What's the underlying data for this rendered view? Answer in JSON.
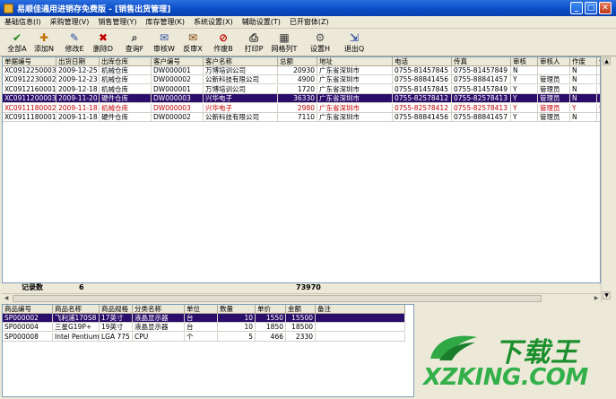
{
  "window": {
    "title": "易顺佳通用进销存免费版 - [销售出货管理]"
  },
  "menu": [
    "基础信息(I)",
    "采购管理(V)",
    "销售管理(Y)",
    "库存管理(K)",
    "系统设置(X)",
    "辅助设置(T)",
    "已开窗体(Z)"
  ],
  "toolbar": [
    {
      "label": "全部A",
      "icon": "check-icon",
      "glyph": "✔",
      "color": "#1f8a1f"
    },
    {
      "label": "添加N",
      "icon": "add-icon",
      "glyph": "✚",
      "color": "#c07000"
    },
    {
      "label": "修改E",
      "icon": "edit-icon",
      "glyph": "✎",
      "color": "#2c4fa0"
    },
    {
      "label": "删除D",
      "icon": "delete-icon",
      "glyph": "✖",
      "color": "#c00000"
    },
    {
      "label": "查询F",
      "icon": "search-icon",
      "glyph": "⌕",
      "color": "#333333"
    },
    {
      "label": "审核W",
      "icon": "approve-icon",
      "glyph": "✉",
      "color": "#2c4fa0"
    },
    {
      "label": "反审X",
      "icon": "unapprove-icon",
      "glyph": "✉",
      "color": "#7a3b00"
    },
    {
      "label": "作废B",
      "icon": "void-icon",
      "glyph": "⊘",
      "color": "#c00000"
    },
    {
      "label": "打印P",
      "icon": "print-icon",
      "glyph": "⎙",
      "color": "#333333"
    },
    {
      "label": "网格列T",
      "icon": "grid-columns-icon",
      "glyph": "▦",
      "color": "#333333"
    },
    {
      "label": "设置H",
      "icon": "settings-icon",
      "glyph": "⚙",
      "color": "#555555"
    },
    {
      "label": "退出Q",
      "icon": "exit-icon",
      "glyph": "⇲",
      "color": "#2c4fa0"
    }
  ],
  "orders": {
    "headers": [
      "单据编号",
      "出货日期",
      "出库仓库",
      "客户编号",
      "客户名称",
      "总额",
      "地址",
      "电话",
      "传真",
      "审核",
      "审核人",
      "作废",
      "作废"
    ],
    "rows": [
      [
        "XC0912250003",
        "2009-12-25",
        "机械仓库",
        "DW000001",
        "万博培训公司",
        "20930",
        "广东省深圳市",
        "0755-81457845",
        "0755-81457849",
        "N",
        "",
        "N",
        ""
      ],
      [
        "XC0912230002",
        "2009-12-23",
        "机械仓库",
        "DW000002",
        "公新科技有限公司",
        "4900",
        "广东省深圳市",
        "0755-88841456",
        "0755-88841457",
        "Y",
        "管理员",
        "N",
        ""
      ],
      [
        "XC0912160001",
        "2009-12-18",
        "机械仓库",
        "DW000001",
        "万博培训公司",
        "1720",
        "广东省深圳市",
        "0755-81457845",
        "0755-81457849",
        "Y",
        "管理员",
        "N",
        ""
      ],
      [
        "XC0911200003",
        "2009-11-20",
        "硬件仓库",
        "DW000003",
        "兴华电子",
        "36330",
        "广东省深圳市",
        "0755-82578412",
        "0755-82578413",
        "Y",
        "管理员",
        "N",
        ""
      ],
      [
        "XC0911180002",
        "2009-11-18",
        "机械仓库",
        "DW000003",
        "兴华电子",
        "2980",
        "广东省深圳市",
        "0755-82578412",
        "0755-82578413",
        "Y",
        "管理员",
        "Y",
        "管理"
      ],
      [
        "XC0911180001",
        "2009-11-18",
        "硬件仓库",
        "DW000002",
        "公新科技有限公司",
        "7110",
        "广东省深圳市",
        "0755-88841456",
        "0755-88841457",
        "Y",
        "管理员",
        "N",
        ""
      ]
    ],
    "selected_row": 3,
    "voided_row": 4,
    "footer_label": "记录数",
    "footer_count": "6",
    "footer_total": "73970"
  },
  "items": {
    "headers": [
      "商品编号",
      "商品名称",
      "商品规格",
      "分类名称",
      "单位",
      "数量",
      "单价",
      "金额",
      "备注"
    ],
    "rows": [
      [
        "SP000002",
        "飞利浦170S8",
        "17英寸",
        "液晶显示器",
        "台",
        "10",
        "1550",
        "15500",
        ""
      ],
      [
        "SP000004",
        "三星G19P+",
        "19英寸",
        "液晶显示器",
        "台",
        "10",
        "1850",
        "18500",
        ""
      ],
      [
        "SP000008",
        "Intel Pentium E2140",
        "LGA 775",
        "CPU",
        "个",
        "5",
        "466",
        "2330",
        ""
      ]
    ],
    "selected_row": 0
  },
  "watermark": {
    "logo": "下载王",
    "url": "XZKING.COM"
  }
}
